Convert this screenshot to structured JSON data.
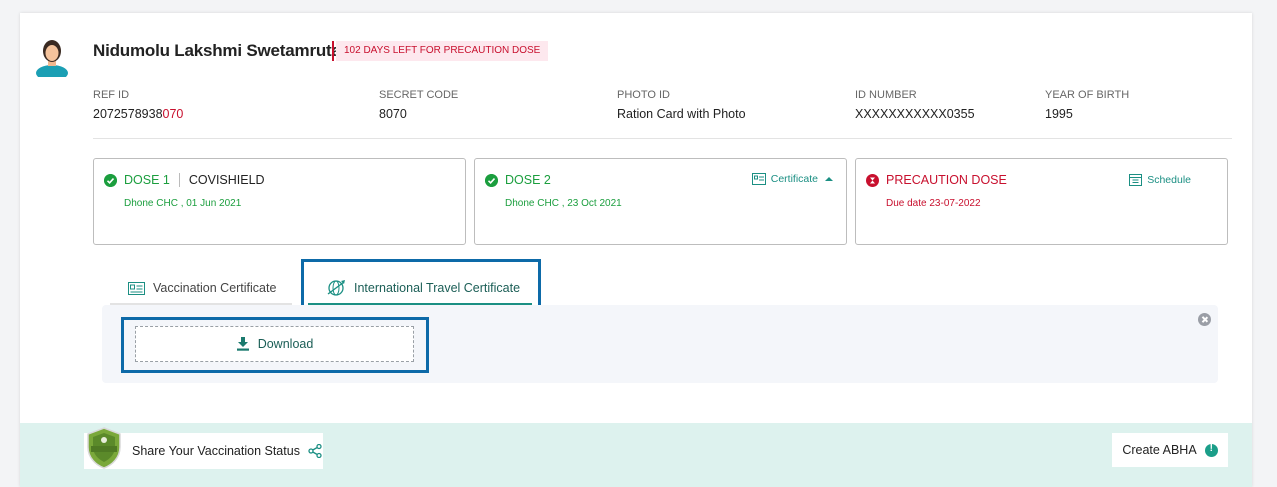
{
  "beneficiary": {
    "name": "Nidumolu Lakshmi Swetamruta",
    "badge": "102 DAYS LEFT FOR PRECAUTION DOSE"
  },
  "meta": {
    "ref_id": {
      "label": "REF ID",
      "value_prefix": "2072578938",
      "value_highlight": "070"
    },
    "secret_code": {
      "label": "SECRET CODE",
      "value": "8070"
    },
    "photo_id": {
      "label": "PHOTO ID",
      "value": "Ration Card with Photo"
    },
    "id_number": {
      "label": "ID NUMBER",
      "value": "XXXXXXXXXXX0355"
    },
    "year_of_birth": {
      "label": "YEAR OF BIRTH",
      "value": "1995"
    }
  },
  "doses": [
    {
      "title": "DOSE 1",
      "vaccine": "COVISHIELD",
      "detail": "Dhone CHC , 01 Jun 2021"
    },
    {
      "title": "DOSE 2",
      "detail": "Dhone CHC , 23 Oct 2021",
      "link": "Certificate"
    },
    {
      "title": "PRECAUTION DOSE",
      "detail": "Due date 23-07-2022",
      "link": "Schedule"
    }
  ],
  "tabs": {
    "vaccination": "Vaccination Certificate",
    "travel": "International Travel Certificate"
  },
  "download_label": "Download",
  "footer": {
    "share_label": "Share Your Vaccination Status",
    "abha_label": "Create ABHA"
  },
  "colors": {
    "accent": "#1b8f83",
    "success": "#1b9e3e",
    "danger": "#c8102e",
    "highlight_border": "#0d6aa8",
    "footer_bg": "#ddf2ee"
  }
}
